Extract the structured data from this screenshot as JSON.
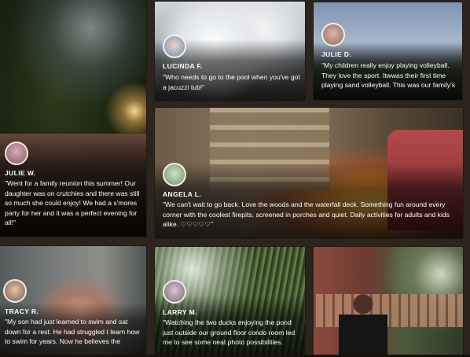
{
  "testimonials": [
    {
      "id": "julie-w",
      "name": "JULIE W.",
      "quote": "\"Went for a family reunion this summer! Our daughter was on crutchies and there was still so much she could enjoy! We had a s'mores party for her and it was a perfect evening for all!\"",
      "photo": "trees-night-porch"
    },
    {
      "id": "lucinda-f",
      "name": "LUCINDA F.",
      "quote": "\"Who needs to go to the pool when you've got a jacuzzi tub!\"",
      "photo": "bubble-bath"
    },
    {
      "id": "julie-d",
      "name": "JULIE D.",
      "quote": "\"My children really enjoy playing volleyball. They love the sport. Itwwas their first time playing sand volleyball. This was our family's",
      "photo": "sand-volleyball"
    },
    {
      "id": "angela-l",
      "name": "ANGELA L.",
      "quote": "\"We can't wait to go back. Love the woods and the waterfall deck. Something fun around every corner with the coolest firepits, screened in porches and quiet. Daily activities for adults and kids alike. ♡♡♡♡♡\"",
      "photo": "firepit-deck"
    },
    {
      "id": "tracy-r",
      "name": "TRACY R.",
      "quote": "\"My son had just learned to swim and sat down for a rest. He had struggled t learn how to swim for years. Now he believes the",
      "photo": "boy-pool"
    },
    {
      "id": "larry-m",
      "name": "LARRY M.",
      "quote": "\"Watching the two ducks enjoying the pond just outside our ground floor condo room led me to see some neat photo possibilities.",
      "photo": "pond-reeds"
    },
    {
      "id": "guest-cabin",
      "name": "",
      "quote": "",
      "photo": "woman-cabin-deck"
    }
  ],
  "colors": {
    "background": "#2b251e",
    "text": "#ffffff"
  }
}
